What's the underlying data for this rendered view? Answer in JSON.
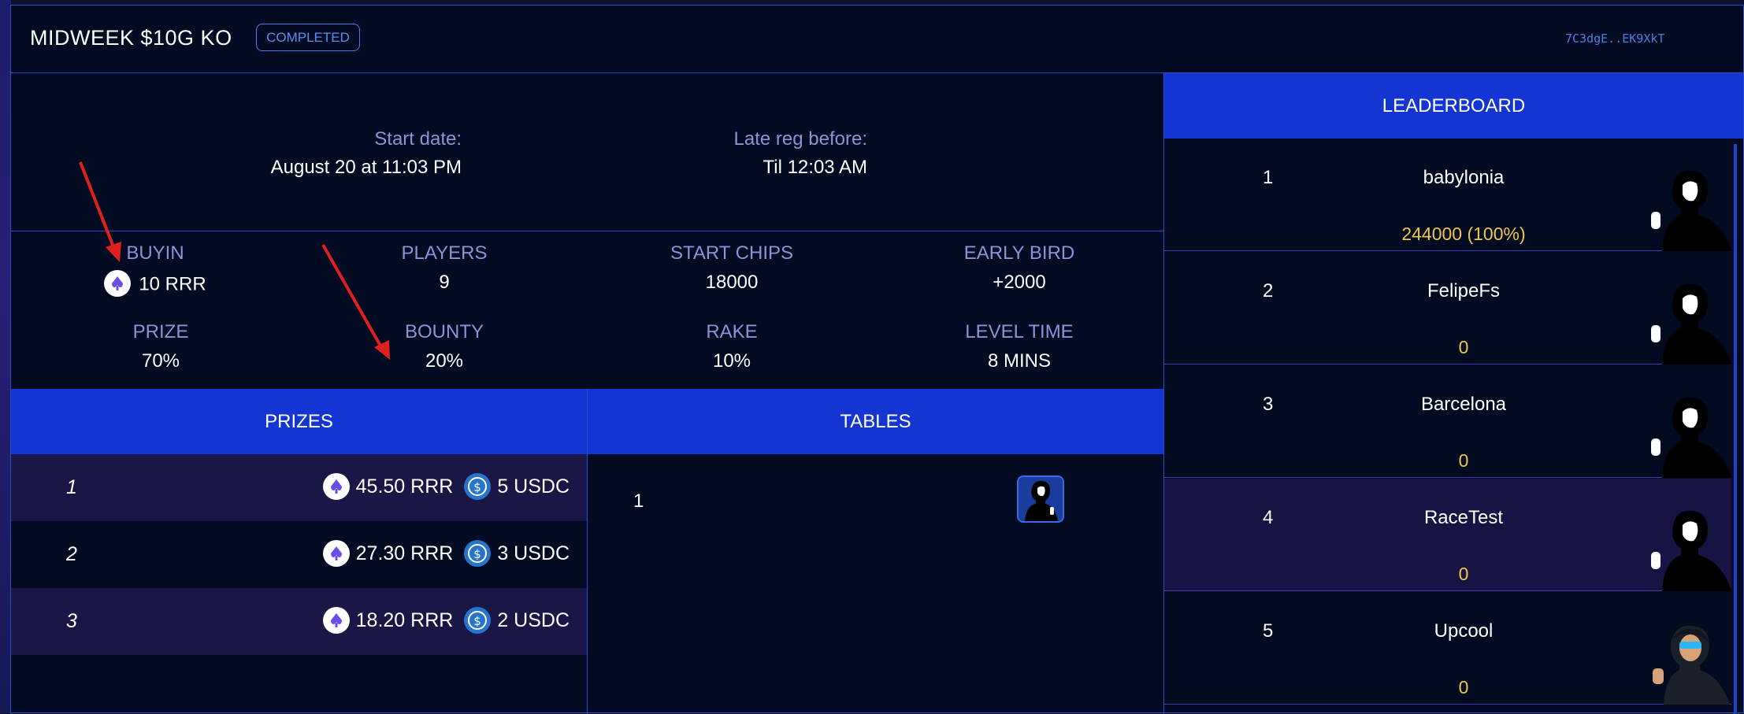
{
  "header": {
    "title": "MIDWEEK $10G KO",
    "status_badge": "COMPLETED",
    "address": "7C3dgE..EK9XkT"
  },
  "info": {
    "start_label": "Start date:",
    "start_value": "August 20 at 11:03 PM",
    "latereg_label": "Late reg before:",
    "latereg_value": "Til 12:03 AM"
  },
  "stats": {
    "buyin": {
      "label": "BUYIN",
      "value": "10 RRR"
    },
    "players": {
      "label": "PLAYERS",
      "value": "9"
    },
    "start_chips": {
      "label": "START CHIPS",
      "value": "18000"
    },
    "early_bird": {
      "label": "EARLY BIRD",
      "value": "+2000"
    },
    "prize": {
      "label": "PRIZE",
      "value": "70%"
    },
    "bounty": {
      "label": "BOUNTY",
      "value": "20%"
    },
    "rake": {
      "label": "RAKE",
      "value": "10%"
    },
    "level_time": {
      "label": "LEVEL TIME",
      "value": "8 MINS"
    }
  },
  "prizes": {
    "heading": "PRIZES",
    "rows": [
      {
        "rank": "1",
        "rrr": "45.50 RRR",
        "usdc": "5 USDC"
      },
      {
        "rank": "2",
        "rrr": "27.30 RRR",
        "usdc": "3 USDC"
      },
      {
        "rank": "3",
        "rrr": "18.20 RRR",
        "usdc": "2 USDC"
      }
    ]
  },
  "tables": {
    "heading": "TABLES",
    "rows": [
      {
        "number": "1"
      }
    ]
  },
  "leaderboard": {
    "heading": "LEADERBOARD",
    "rows": [
      {
        "pos": "1",
        "name": "babylonia",
        "chips": "244000  (100%)"
      },
      {
        "pos": "2",
        "name": "FelipeFs",
        "chips": "0"
      },
      {
        "pos": "3",
        "name": "Barcelona",
        "chips": "0"
      },
      {
        "pos": "4",
        "name": "RaceTest",
        "chips": "0"
      },
      {
        "pos": "5",
        "name": "Upcool",
        "chips": "0"
      }
    ]
  },
  "colors": {
    "accent_blue": "#1435d1",
    "chips_gold": "#f0c649",
    "annotation_red": "#e0201e"
  },
  "icons": {
    "rrr_coin": "rrr-coin-icon",
    "usdc_coin": "usdc-coin-icon",
    "player_avatar": "silhouette-avatar-icon"
  }
}
